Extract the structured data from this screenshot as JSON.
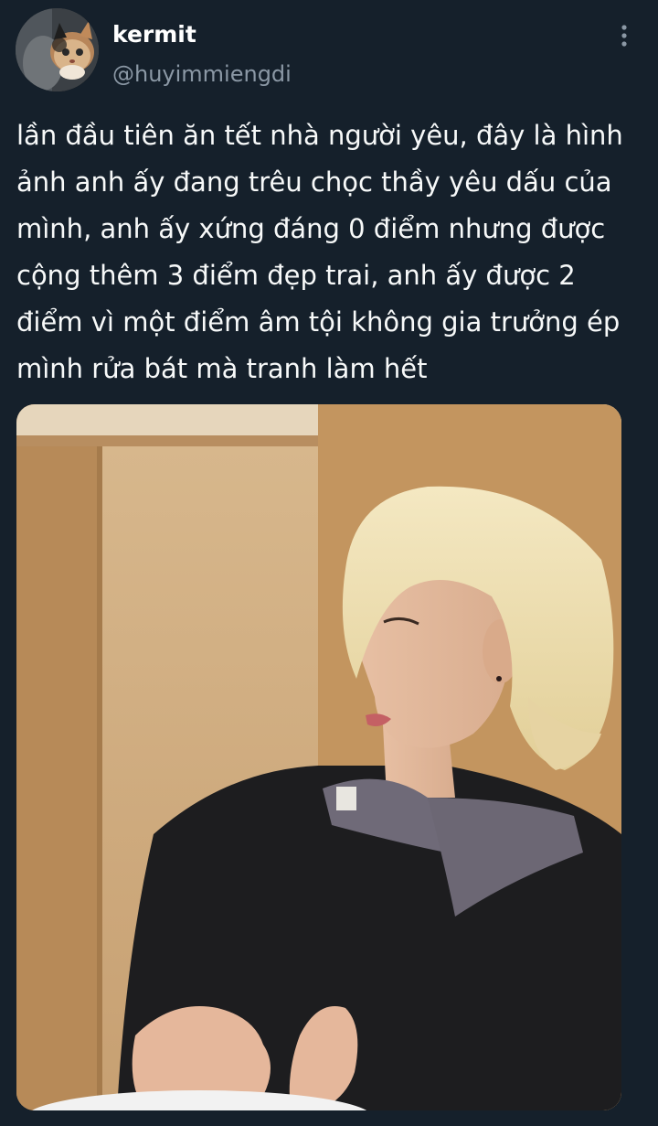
{
  "tweet": {
    "author": {
      "display_name": "kermit",
      "handle": "@huyimmiengdi",
      "avatar_icon": "cat-avatar"
    },
    "more_icon": "more-vertical-icon",
    "text": "lần đầu tiên ăn tết nhà người yêu, đây là hình\nảnh anh ấy đang trêu chọc thầy yêu dấu của\nmình, anh ấy xứng đáng 0 điểm nhưng được\ncộng thêm 3 điểm đẹp trai, anh ấy được 2\nđiểm vì một điểm âm tội không gia trưởng ép\nmình rửa bát mà tranh làm hết",
    "media": {
      "type": "photo"
    }
  },
  "colors": {
    "background": "#15202b",
    "text_primary": "#f7f9f9",
    "text_secondary": "#8b98a5"
  }
}
